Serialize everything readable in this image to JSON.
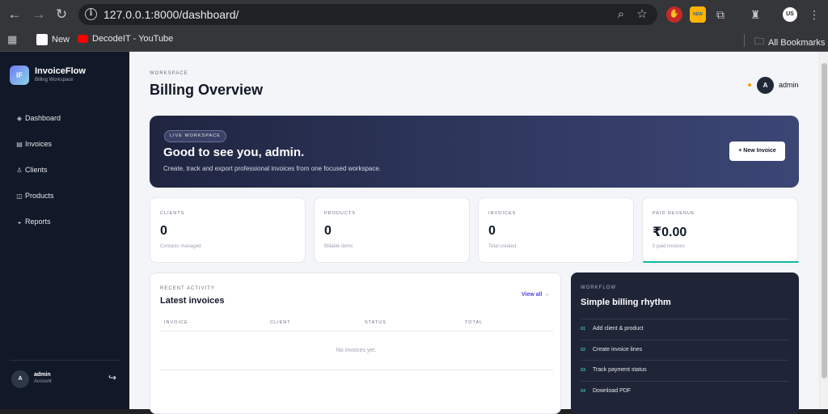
{
  "browser": {
    "url": "127.0.0.1:8000/dashboard/",
    "bookmarks": [
      {
        "label": "New"
      },
      {
        "label": "DecodeIT - YouTube"
      }
    ],
    "all_bookmarks": "All Bookmarks",
    "profile_initials": "US",
    "ext_badge": "NEW"
  },
  "sidebar": {
    "logo": "IF",
    "brand": "InvoiceFlow",
    "brand_sub": "Billing Workspace",
    "items": [
      {
        "label": "Dashboard",
        "icon": "◈"
      },
      {
        "label": "Invoices",
        "icon": "▤"
      },
      {
        "label": "Clients",
        "icon": "♙"
      },
      {
        "label": "Products",
        "icon": "◫"
      },
      {
        "label": "Reports",
        "icon": "◒"
      }
    ],
    "user": {
      "initial": "A",
      "name": "admin",
      "role": "Account"
    }
  },
  "header": {
    "eyebrow": "WORKSPACE",
    "title": "Billing Overview",
    "avatar": "A",
    "user": "admin"
  },
  "hero": {
    "pill": "LIVE WORKSPACE",
    "title": "Good to see you, admin.",
    "subtitle": "Create, track and export professional invoices from one focused workspace.",
    "button": "+ New Invoice"
  },
  "stats": [
    {
      "label": "CLIENTS",
      "value": "0",
      "sub": "Contacts managed"
    },
    {
      "label": "PRODUCTS",
      "value": "0",
      "sub": "Billable items"
    },
    {
      "label": "INVOICES",
      "value": "0",
      "sub": "Total created"
    },
    {
      "label": "PAID REVENUE",
      "value": "₹0.00",
      "sub": "0 paid invoices"
    }
  ],
  "activity": {
    "eyebrow": "RECENT ACTIVITY",
    "title": "Latest invoices",
    "view_all": "View all →",
    "columns": [
      "INVOICE",
      "CLIENT",
      "STATUS",
      "TOTAL"
    ],
    "empty": "No invoices yet."
  },
  "workflow": {
    "eyebrow": "WORKFLOW",
    "title": "Simple billing rhythm",
    "steps": [
      {
        "num": "01",
        "text": "Add client & product"
      },
      {
        "num": "02",
        "text": "Create invoice lines"
      },
      {
        "num": "03",
        "text": "Track payment status"
      },
      {
        "num": "04",
        "text": "Download PDF"
      }
    ]
  },
  "colors": {
    "sidebar_bg": "#111827",
    "accent": "#4f46e5",
    "revenue_accent": "#14b8a6",
    "status_dot": "#f59e0b"
  }
}
